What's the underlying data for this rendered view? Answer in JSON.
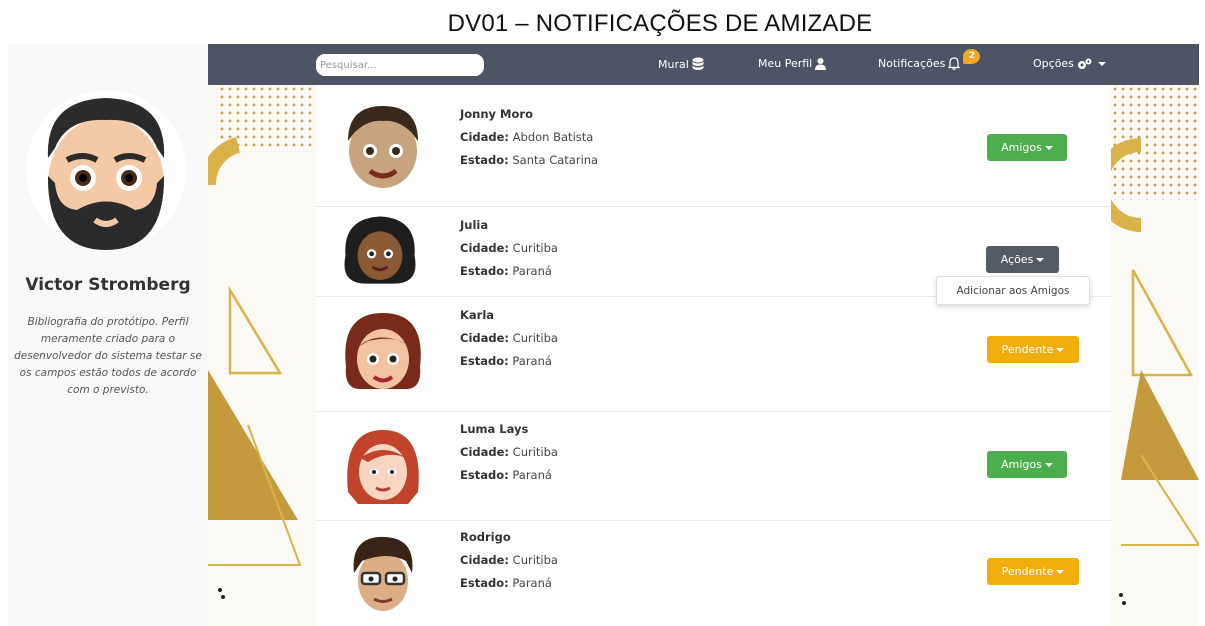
{
  "caption": "DV01 – NOTIFICAÇÕES DE AMIZADE",
  "profile": {
    "name": "Victor Stromberg",
    "bio": "Bibliografia do protótipo. Perfil meramente criado para o desenvolvedor do sistema testar se os campos estão todos de acordo com o previsto."
  },
  "navbar": {
    "search_placeholder": "Pesquisar...",
    "mural": "Mural",
    "meu_perfil": "Meu Perfil",
    "notificacoes": "Notificações",
    "notif_count": "2",
    "opcoes": "Opções"
  },
  "labels": {
    "cidade": "Cidade:",
    "estado": "Estado:"
  },
  "friends": [
    {
      "name": "Jonny Moro",
      "cidade": "Abdon Batista",
      "estado": "Santa Catarina",
      "button": "Amigos",
      "status": "green"
    },
    {
      "name": "Julia",
      "cidade": "Curitiba",
      "estado": "Paraná",
      "button": "Ações",
      "status": "dark"
    },
    {
      "name": "Karla",
      "cidade": "Curitiba",
      "estado": "Paraná",
      "button": "Pendente",
      "status": "orange"
    },
    {
      "name": "Luma Lays",
      "cidade": "Curitiba",
      "estado": "Paraná",
      "button": "Amigos",
      "status": "green"
    },
    {
      "name": "Rodrigo",
      "cidade": "Curitiba",
      "estado": "Paraná",
      "button": "Pendente",
      "status": "orange"
    }
  ],
  "dropdown": {
    "item": "Adicionar aos Amigos"
  },
  "colors": {
    "navbar": "#4d5466",
    "green": "#4cae4c",
    "dark": "#545b67",
    "orange": "#f0ad0e",
    "accent_gold": "#c9a14a"
  }
}
